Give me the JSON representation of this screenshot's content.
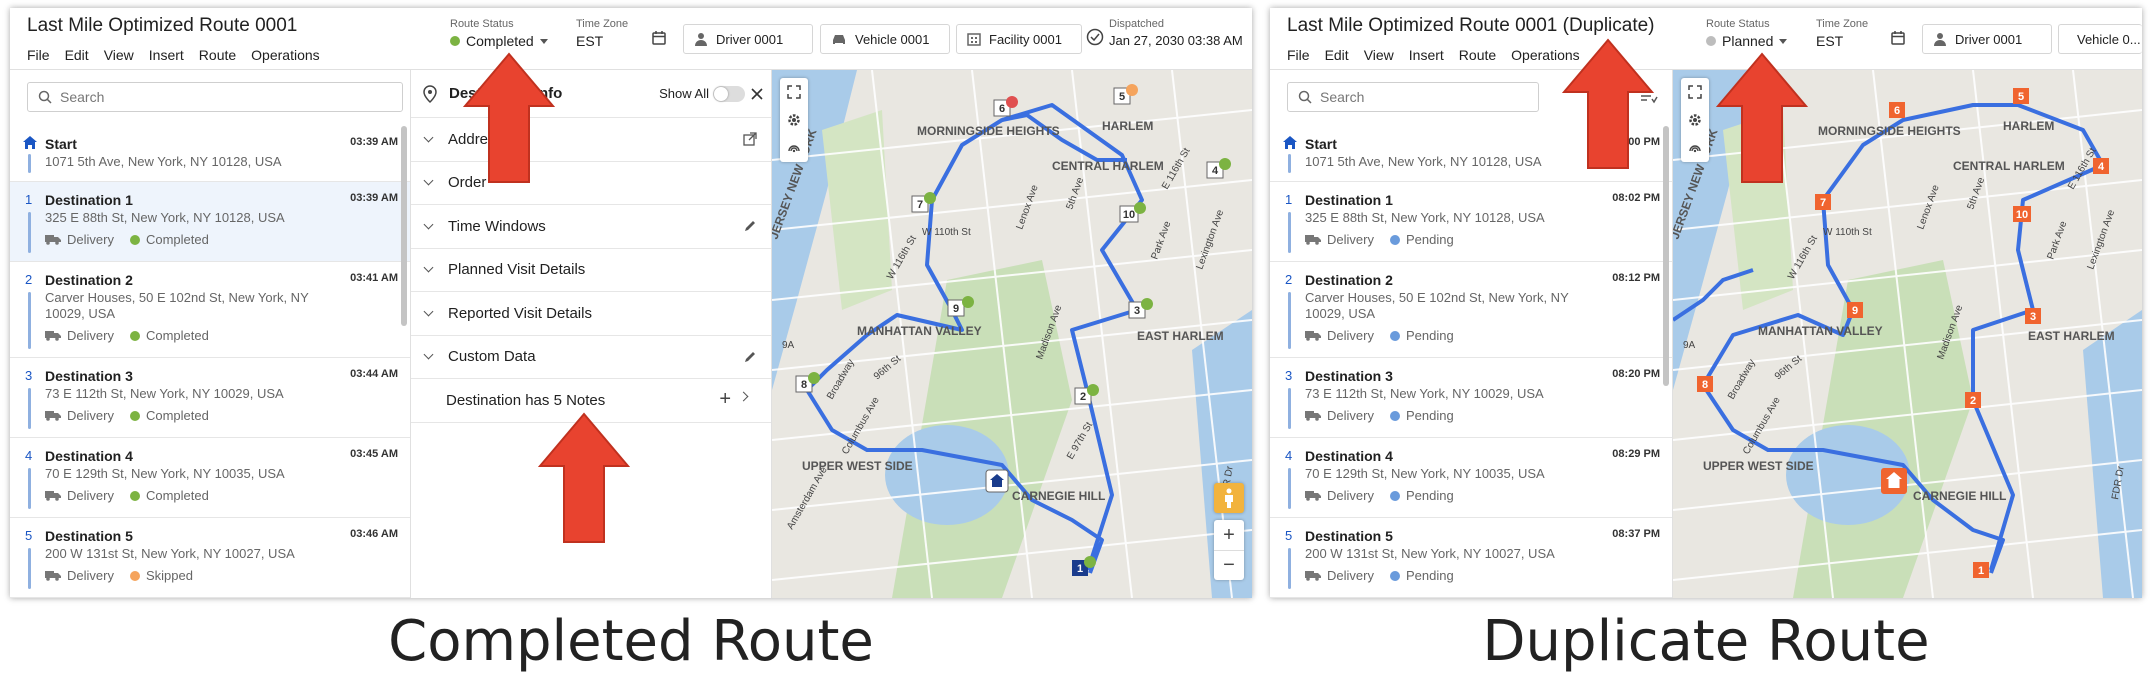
{
  "left": {
    "title": "Last Mile Optimized Route 0001",
    "menu": [
      "File",
      "Edit",
      "View",
      "Insert",
      "Route",
      "Operations"
    ],
    "route_status_label": "Route Status",
    "route_status_value": "Completed",
    "route_status_color": "#7cb342",
    "time_zone_label": "Time Zone",
    "time_zone_value": "EST",
    "driver": "Driver 0001",
    "vehicle": "Vehicle 0001",
    "facility": "Facility 0001",
    "dispatched_label": "Dispatched",
    "dispatched_value": "Jan 27, 2030 03:38 AM",
    "search_placeholder": "Search",
    "stops": [
      {
        "num": "",
        "name": "Start",
        "address": "1071 5th Ave, New York, NY 10128, USA",
        "time": "03:39 AM"
      },
      {
        "num": "1",
        "name": "Destination 1",
        "address": "325 E 88th St, New York, NY 10128, USA",
        "time": "03:39 AM",
        "type": "Delivery",
        "status": "Completed"
      },
      {
        "num": "2",
        "name": "Destination 2",
        "address": "Carver Houses, 50 E 102nd St, New York, NY 10029, USA",
        "time": "03:41 AM",
        "type": "Delivery",
        "status": "Completed"
      },
      {
        "num": "3",
        "name": "Destination 3",
        "address": "73 E 112th St, New York, NY 10029, USA",
        "time": "03:44 AM",
        "type": "Delivery",
        "status": "Completed"
      },
      {
        "num": "4",
        "name": "Destination 4",
        "address": "70 E 129th St, New York, NY 10035, USA",
        "time": "03:45 AM",
        "type": "Delivery",
        "status": "Completed"
      },
      {
        "num": "5",
        "name": "Destination 5",
        "address": "200 W 131st St, New York, NY 10027, USA",
        "time": "03:46 AM",
        "type": "Delivery",
        "status": "Skipped"
      }
    ],
    "details": {
      "title": "Destination Info",
      "show_all": "Show All",
      "rows": [
        "Address",
        "Order",
        "Time Windows",
        "Planned Visit Details",
        "Reported Visit Details",
        "Custom Data"
      ],
      "notes": "Destination has 5 Notes"
    },
    "map_labels": [
      "MORNINGSIDE HEIGHTS",
      "HARLEM",
      "CENTRAL HARLEM",
      "JERSEY NEW YORK",
      "MANHATTAN VALLEY",
      "EAST HARLEM",
      "UPPER WEST SIDE",
      "CARNEGIE HILL",
      "W 110th St",
      "W 116th St",
      "Lenox Ave",
      "Lexington Ave",
      "Park Ave",
      "5th Ave",
      "Madison Ave",
      "Columbus Ave",
      "Broadway",
      "Amsterdam Ave",
      "96th St",
      "E 97th St",
      "E 116th St",
      "FDR Dr",
      "9A"
    ],
    "caption": "Completed Route"
  },
  "right": {
    "title": "Last Mile Optimized Route 0001 (Duplicate)",
    "menu": [
      "File",
      "Edit",
      "View",
      "Insert",
      "Route",
      "Operations"
    ],
    "route_status_label": "Route Status",
    "route_status_value": "Planned",
    "route_status_color": "#bdbdbd",
    "time_zone_label": "Time Zone",
    "time_zone_value": "EST",
    "driver": "Driver 0001",
    "vehicle": "Vehicle 0...",
    "search_placeholder": "Search",
    "stops": [
      {
        "num": "",
        "name": "Start",
        "address": "1071 5th Ave, New York, NY 10128, USA",
        "time": "08:00 PM"
      },
      {
        "num": "1",
        "name": "Destination 1",
        "address": "325 E 88th St, New York, NY 10128, USA",
        "time": "08:02 PM",
        "type": "Delivery",
        "status": "Pending"
      },
      {
        "num": "2",
        "name": "Destination 2",
        "address": "Carver Houses, 50 E 102nd St, New York, NY 10029, USA",
        "time": "08:12 PM",
        "type": "Delivery",
        "status": "Pending"
      },
      {
        "num": "3",
        "name": "Destination 3",
        "address": "73 E 112th St, New York, NY 10029, USA",
        "time": "08:20 PM",
        "type": "Delivery",
        "status": "Pending"
      },
      {
        "num": "4",
        "name": "Destination 4",
        "address": "70 E 129th St, New York, NY 10035, USA",
        "time": "08:29 PM",
        "type": "Delivery",
        "status": "Pending"
      },
      {
        "num": "5",
        "name": "Destination 5",
        "address": "200 W 131st St, New York, NY 10027, USA",
        "time": "08:37 PM",
        "type": "Delivery",
        "status": "Pending"
      }
    ],
    "map_labels": [
      "MORNINGSIDE HEIGHTS",
      "HARLEM",
      "CENTRAL HARLEM",
      "JERSEY NEW YORK",
      "MANHATTAN VALLEY",
      "EAST HARLEM",
      "UPPER WEST SIDE",
      "CARNEGIE HILL",
      "W 110th St",
      "W 116th St",
      "Lenox Ave",
      "Lexington Ave",
      "Park Ave",
      "5th Ave",
      "Madison Ave",
      "Columbus Ave",
      "Broadway",
      "E 116th St",
      "96th St",
      "FDR Dr",
      "9A"
    ],
    "caption": "Duplicate Route"
  },
  "colors": {
    "completed": "#7cb342",
    "skipped": "#f5a45d",
    "pending": "#6a9bdc",
    "route_line": "#3a6fe0",
    "marker_completed": "#ffffff",
    "marker_planned": "#f0642f",
    "arrow": "#e8432f"
  }
}
